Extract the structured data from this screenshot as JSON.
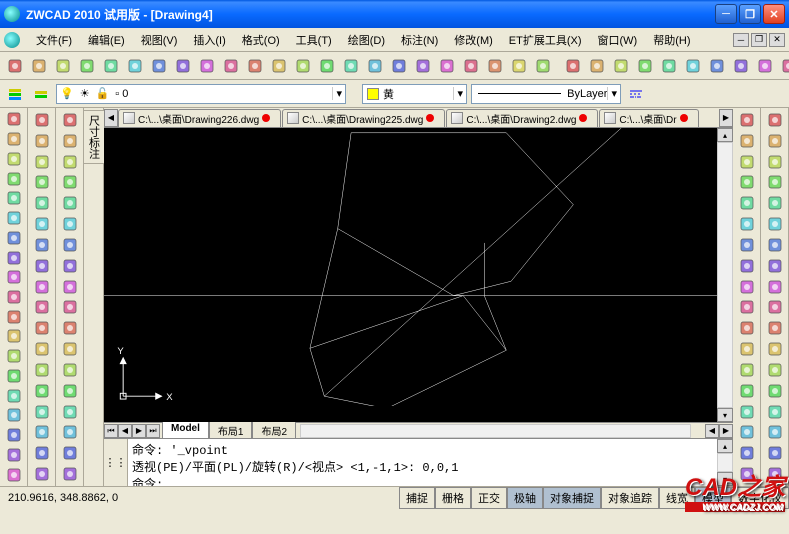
{
  "title": "ZWCAD 2010 试用版 - [Drawing4]",
  "menus": [
    {
      "label": "文件(F)"
    },
    {
      "label": "编辑(E)"
    },
    {
      "label": "视图(V)"
    },
    {
      "label": "插入(I)"
    },
    {
      "label": "格式(O)"
    },
    {
      "label": "工具(T)"
    },
    {
      "label": "绘图(D)"
    },
    {
      "label": "标注(N)"
    },
    {
      "label": "修改(M)"
    },
    {
      "label": "ET扩展工具(X)"
    },
    {
      "label": "窗口(W)"
    },
    {
      "label": "帮助(H)"
    }
  ],
  "layer_selector": "0",
  "color_selector": "黄",
  "linetype_selector": "ByLayer",
  "doc_tabs": [
    {
      "label": "C:\\...\\桌面\\Drawing226.dwg"
    },
    {
      "label": "C:\\...\\桌面\\Drawing225.dwg"
    },
    {
      "label": "C:\\...\\桌面\\Drawing2.dwg"
    },
    {
      "label": "C:\\...\\桌面\\Dr"
    }
  ],
  "model_tabs": {
    "model": "Model",
    "layout1": "布局1",
    "layout2": "布局2"
  },
  "cmd_lines": "命令: '_vpoint\n透视(PE)/平面(PL)/旋转(R)/<视点> <1,-1,1>: 0,0,1\n命令:",
  "status": {
    "coords": "210.9616, 348.8862, 0",
    "buttons": [
      "捕捉",
      "栅格",
      "正交",
      "极轴",
      "对象捕捉",
      "对象追踪",
      "线宽",
      "模型",
      "数字化仪"
    ]
  },
  "axis": {
    "x": "X",
    "y": "Y"
  },
  "side_label": "尺寸标注",
  "watermark": {
    "main": "CAD之家",
    "sub": "WWW.CADZJ.COM"
  },
  "toolbar1_icons": [
    "new-icon",
    "open-icon",
    "save-icon",
    "print-icon",
    "plot-preview-icon",
    "publish-icon",
    "cut-icon",
    "copy-icon",
    "paste-icon",
    "match-icon",
    "undo-icon",
    "redo-icon",
    "erase-icon",
    "layers-icon",
    "pan-icon",
    "zoom-icon",
    "zoom-window-icon",
    "zoom-prev-icon",
    "properties-icon",
    "design-center-icon",
    "tool-palette-icon",
    "calc-icon",
    "help-icon"
  ],
  "toolbar1b_icons": [
    "box-icon",
    "sphere-icon",
    "cylinder-icon",
    "cone-icon",
    "wedge-icon",
    "torus-icon",
    "region-icon",
    "extrude-icon",
    "revolve-icon",
    "slice-icon",
    "section-icon"
  ],
  "left_tools_a": [
    "line-icon",
    "xline-icon",
    "pline-icon",
    "polygon-icon",
    "rectangle-icon",
    "arc-icon",
    "circle-icon",
    "revcloud-icon",
    "spline-icon",
    "ellipse-icon",
    "ellipse-arc-icon",
    "insert-icon",
    "block-icon",
    "point-icon",
    "hatch-icon",
    "gradient-icon",
    "region2-icon",
    "table-icon",
    "mtext-icon"
  ],
  "left_tools_b": [
    "dim1-icon",
    "dim2-icon",
    "dim3-icon",
    "dim4-icon",
    "dim5-icon",
    "dim6-icon",
    "dim7-icon",
    "dim8-icon",
    "dim9-icon",
    "dim10-icon",
    "dim11-icon",
    "dim12-icon",
    "dim13-icon",
    "dim14-icon",
    "dim15-icon",
    "dim16-icon",
    "dim17-icon",
    "dim18-icon"
  ],
  "left_tools_c": [
    "erase2-icon",
    "copy2-icon",
    "mirror-icon",
    "offset-icon",
    "array-icon",
    "move-icon",
    "rotate-icon",
    "scale-icon",
    "stretch-icon",
    "trim-icon",
    "extend-icon",
    "break-icon",
    "join-icon",
    "chamfer-icon",
    "fillet-icon",
    "explode-icon",
    "c17-icon",
    "c18-icon"
  ],
  "right_tools_a": [
    "r1-icon",
    "r2-icon",
    "r3-icon",
    "r4-icon",
    "r5-icon",
    "r6-icon",
    "r7-icon",
    "r8-icon",
    "r9-icon",
    "r10-icon",
    "r11-icon",
    "r12-icon",
    "r13-icon",
    "r14-icon",
    "r15-icon",
    "r16-icon",
    "r17-icon",
    "r18-icon"
  ],
  "right_tools_b": [
    "s1-icon",
    "s2-icon",
    "s3-icon",
    "s4-icon",
    "s5-icon",
    "s6-icon",
    "s7-icon",
    "s8-icon",
    "s9-icon",
    "s10-icon",
    "s11-icon",
    "s12-icon",
    "s13-icon",
    "s14-icon",
    "s15-icon",
    "s16-icon",
    "s17-icon",
    "s18-icon"
  ],
  "colors": {
    "accent": "#0a6aff",
    "canvas": "#000000",
    "panel": "#ece9d8"
  }
}
